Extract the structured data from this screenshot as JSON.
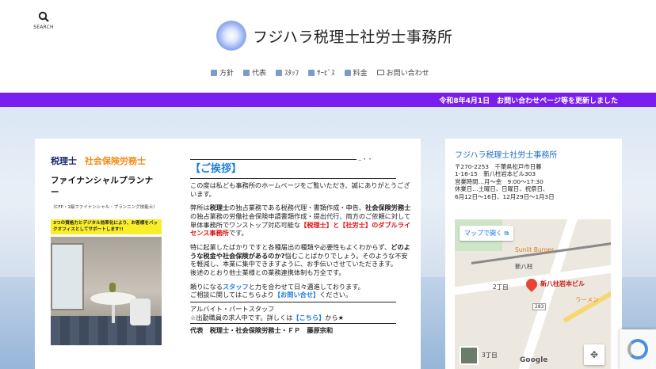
{
  "header": {
    "search_label": "SEARCH",
    "site_title": "フジハラ税理士社労士事務所"
  },
  "nav": {
    "items": [
      {
        "label": "方針",
        "icon": "book-icon"
      },
      {
        "label": "代表",
        "icon": "book-icon"
      },
      {
        "label": "ｽﾀｯﾌ",
        "icon": "people-icon"
      },
      {
        "label": "ｻｰﾋﾞｽ",
        "icon": "book-icon"
      },
      {
        "label": "料金",
        "icon": "money-icon"
      },
      {
        "label": "お問い合わせ",
        "icon": "mail-icon"
      }
    ]
  },
  "newsbar": {
    "text": "令和8年4月1日　お問い合わせページ等を更新しました"
  },
  "flyer": {
    "line1a": "税理士",
    "line1b": "社会保険労務士",
    "line2": "ファイナンシャルプランナー",
    "line3": "（CFP・1級ファイナンシャル・プランニング技能士）",
    "banner": "3つの資格力とデジタル効率化により、お客様をバックオフィスとしてサポートします!!"
  },
  "greeting": {
    "dots": "‥・・",
    "heading": "【ご挨拶】",
    "p1": "この度は私ども事務所のホームページをご覧いただき、誠にありがとうございます。",
    "p2a": "弊所は",
    "p2b": "税理士",
    "p2c": "の独占業務である税務代理・書類作成・申告、",
    "p2d": "社会保険労務士",
    "p2e": "の独占業務の労働社会保険申請書類作成・提出代行、両方のご依頼に対して単体事務所でワンストップ対応可能な",
    "p2f": "【税理士】と【社労士】のダブルライセンス事務所",
    "p2g": "です。",
    "p3a": "特に起業したばかりですと各種届出の種類や必要性もよくわからず、",
    "p3b": "どのような税金や社会保険があるのか?",
    "p3c": "悩むことばかりでしょう。そのような不安を軽減し、本業に集中できますように、お手伝いさせていただきます。",
    "p3d": "後述のとおり他士業様との業務連携体制も万全です。",
    "p4a": "頼りになる",
    "p4b": "スタッフ",
    "p4c": "と力を合わせて日々邁進しております。",
    "p4d": "ご相談に関してはこちらより",
    "p4e": "【お問い合せ】",
    "p4f": "ください。",
    "p5a": "アルバイト・パートスタッフ",
    "p5b": "☆出勤職員の求人中です。詳しくは",
    "p5c": "【こちら】",
    "p5d": "から★",
    "signature": "代表　税理士・社会保険労務士・ＦＰ　藤原宗和"
  },
  "sidebar": {
    "title": "フジハラ税理士社労士事務所",
    "address": [
      "〒270-2253　千葉県松戸市日暮",
      "1-16-15　新八柱岩本ビル303",
      "営業時間…月～金　9:00～17:30",
      "休業日…土曜日、日曜日、祝祭日、",
      "6月12日～16日、12月29日～1月3日"
    ],
    "map": {
      "open_label": "マップで開く",
      "labels": {
        "sunlit": "Sunlit Burger",
        "station": "新八柱",
        "office": "新八柱岩本ビル",
        "chome2": "2丁目",
        "ramen": "ラーメン",
        "chome3": "3丁目",
        "road": "283",
        "google": "Google"
      }
    }
  },
  "colors": {
    "accent": "#7a1ef0",
    "heading_blue": "#1e7fe0",
    "red": "#dd1111"
  }
}
